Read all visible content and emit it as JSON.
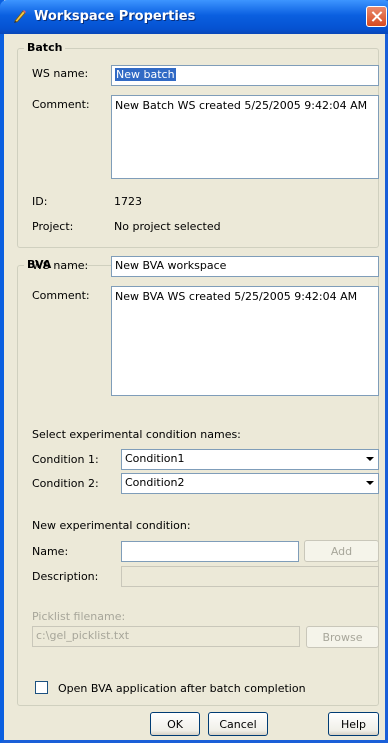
{
  "window": {
    "title": "Workspace Properties"
  },
  "batch": {
    "group_label": "Batch",
    "ws_name_label": "WS name:",
    "ws_name_value": "New batch",
    "comment_label": "Comment:",
    "comment_value": "New Batch WS created 5/25/2005 9:42:04 AM",
    "id_label": "ID:",
    "id_value": "1723",
    "project_label": "Project:",
    "project_value": "No project selected"
  },
  "bva": {
    "group_label": "BVA",
    "ws_name_label": "WS name:",
    "ws_name_value": "New BVA workspace",
    "comment_label": "Comment:",
    "comment_value": "New BVA WS created 5/25/2005 9:42:04 AM",
    "select_conditions_label": "Select experimental condition names:",
    "condition1_label": "Condition 1:",
    "condition1_value": "Condition1",
    "condition2_label": "Condition 2:",
    "condition2_value": "Condition2",
    "new_condition_label": "New experimental condition:",
    "name_label": "Name:",
    "name_value": "",
    "add_label": "Add",
    "description_label": "Description:",
    "description_value": "",
    "picklist_label": "Picklist filename:",
    "picklist_value": "c:\\gel_picklist.txt",
    "browse_label": "Browse",
    "open_bva_label": "Open BVA application after batch completion"
  },
  "buttons": {
    "ok": "OK",
    "cancel": "Cancel",
    "help": "Help"
  },
  "colors": {
    "titlebar": "#0a5fe0",
    "dialog_bg": "#ece9d8",
    "selection": "#316ac5"
  }
}
